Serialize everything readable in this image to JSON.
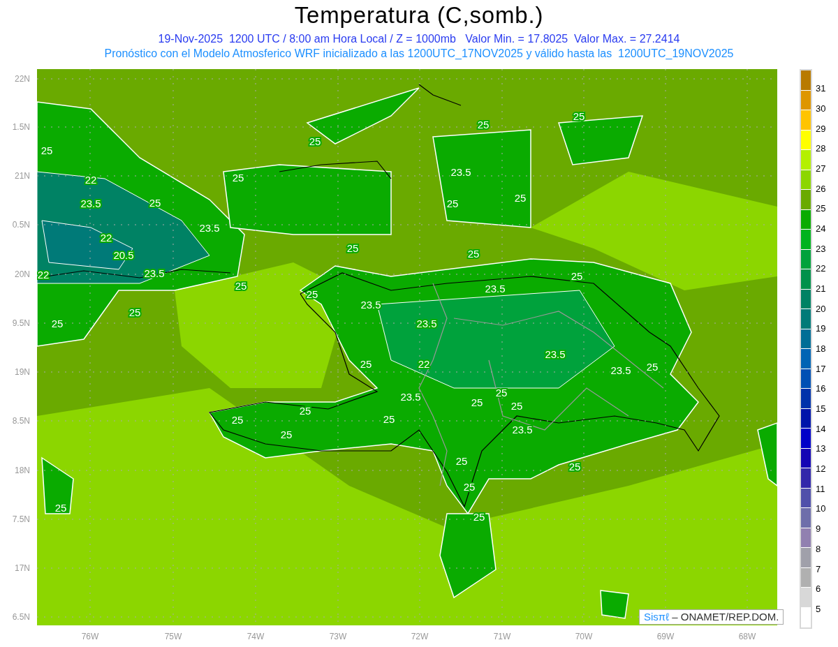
{
  "title": "Temperatura (C,somb.)",
  "subtitle": "19-Nov-2025  1200 UTC / 8:00 am Hora Local / Z = 1000mb   Valor Min. = 17.8025  Valor Max. = 27.2414",
  "description": "Pronóstico con el Modelo Atmosferico WRF inicializado a las 1200UTC_17NOV2025 y válido hasta las  1200UTC_19NOV2025",
  "map": {
    "lat_labels": [
      "22N",
      "1.5N",
      "21N",
      "0.5N",
      "20N",
      "9.5N",
      "19N",
      "8.5N",
      "18N",
      "7.5N",
      "17N",
      "6.5N"
    ],
    "lon_labels": [
      "76W",
      "75W",
      "74W",
      "73W",
      "72W",
      "71W",
      "70W",
      "69W",
      "68W"
    ],
    "contour_labels": [
      "25",
      "25",
      "25",
      "25",
      "22",
      "25",
      "23.5",
      "23.5",
      "25",
      "25",
      "25",
      "23.5",
      "22",
      "25",
      "20.5",
      "25",
      "22",
      "23.5",
      "25",
      "25",
      "23.5",
      "25",
      "23.5",
      "25",
      "25",
      "23.5",
      "23.5",
      "25",
      "22",
      "23.5",
      "25",
      "23.5",
      "25",
      "25",
      "25",
      "25",
      "25",
      "25",
      "23.5",
      "25",
      "25",
      "25",
      "25",
      "25",
      "25"
    ]
  },
  "credit": {
    "brand": "Sisπℓ",
    "text": "– ONAMET/REP.DOM."
  },
  "legend": {
    "labels": [
      "31",
      "30",
      "29",
      "28",
      "27",
      "26",
      "25",
      "24",
      "23",
      "22",
      "21",
      "20",
      "19",
      "18",
      "17",
      "16",
      "15",
      "14",
      "13",
      "12",
      "11",
      "10",
      "9",
      "8",
      "7",
      "6",
      "5"
    ]
  }
}
